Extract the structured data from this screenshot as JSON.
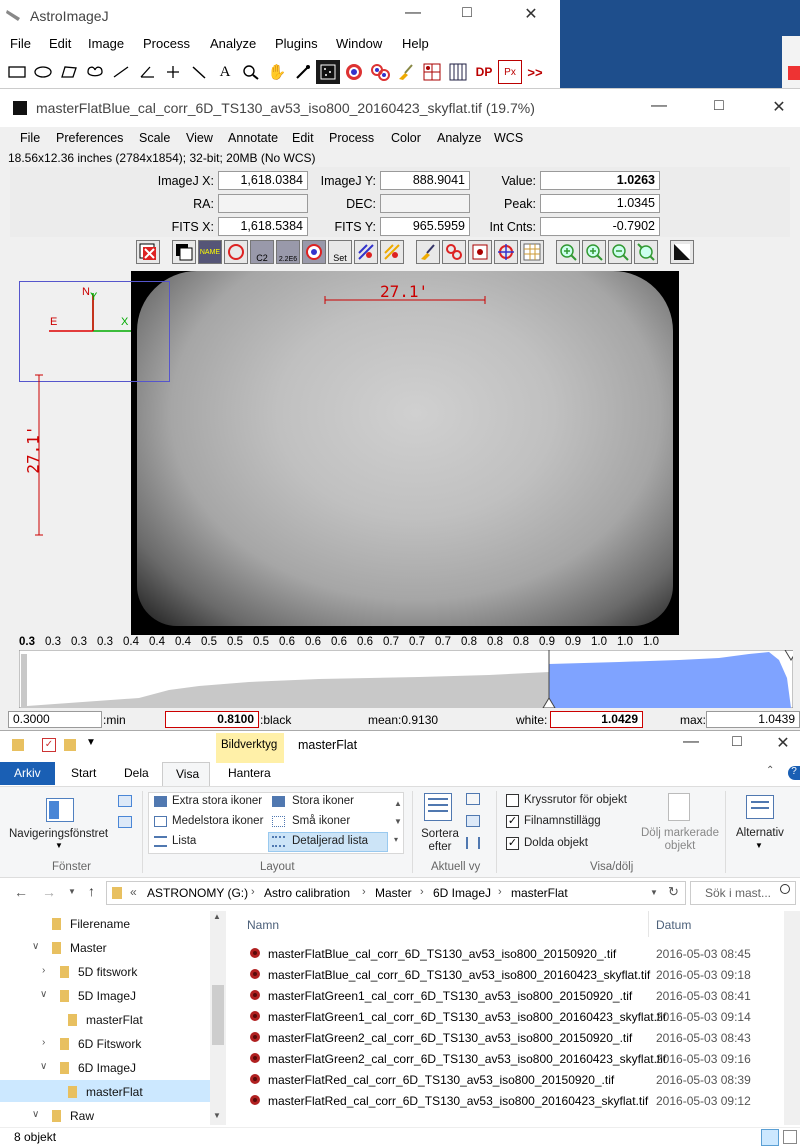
{
  "aij_main": {
    "title": "AstroImageJ",
    "menu": [
      "File",
      "Edit",
      "Image",
      "Process",
      "Analyze",
      "Plugins",
      "Window",
      "Help"
    ],
    "tools_text": {
      "text_tool": "A",
      "dp": "DP",
      "px": "Px",
      "more": ">>"
    }
  },
  "image_window": {
    "title": "masterFlatBlue_cal_corr_6D_TS130_av53_iso800_20160423_skyflat.tif (19.7%)",
    "menu": [
      "File",
      "Preferences",
      "Scale",
      "View",
      "Annotate",
      "Edit",
      "Process",
      "Color",
      "Analyze",
      "WCS"
    ],
    "info": "18.56x12.36 inches (2784x1854); 32-bit; 20MB (No WCS)",
    "fields": {
      "imagej_x_label": "ImageJ X:",
      "imagej_x": "1,618.0384",
      "imagej_y_label": "ImageJ Y:",
      "imagej_y": "888.9041",
      "value_label": "Value:",
      "value": "1.0263",
      "ra_label": "RA:",
      "ra": "",
      "dec_label": "DEC:",
      "dec": "",
      "peak_label": "Peak:",
      "peak": "1.0345",
      "fits_x_label": "FITS X:",
      "fits_x": "1,618.5384",
      "fits_y_label": "FITS Y:",
      "fits_y": "965.5959",
      "int_cnts_label": "Int Cnts:",
      "int_cnts": "-0.7902"
    },
    "icon_text": {
      "c2": "C2",
      "s2e6": "2.2E6",
      "set": "Set",
      "name": "NAME"
    },
    "scale_label": "27.1'",
    "compass": {
      "n": "N",
      "e": "E",
      "y": "Y",
      "x": "X"
    },
    "histogram_ticks": [
      "0.3",
      "0.3",
      "0.3",
      "0.3",
      "0.4",
      "0.4",
      "0.4",
      "0.5",
      "0.5",
      "0.5",
      "0.6",
      "0.6",
      "0.6",
      "0.6",
      "0.7",
      "0.7",
      "0.7",
      "0.8",
      "0.8",
      "0.8",
      "0.9",
      "0.9",
      "1.0",
      "1.0",
      "1.0"
    ],
    "bottom": {
      "min_val": "0.3000",
      "min_label": ":min",
      "black_val": "0.8100",
      "black_label": ":black",
      "mean": "mean:0.9130",
      "white_label": "white:",
      "white_val": "1.0429",
      "max_label": "max:",
      "max_val": "1.0439"
    },
    "colors": {
      "histogram_gray": "#c8c8c8",
      "histogram_blue": "#7fa3ff",
      "annotation_red": "#c00000"
    }
  },
  "explorer": {
    "context_tab": "Bildverktyg",
    "title": "masterFlat",
    "tabs": {
      "arkiv": "Arkiv",
      "start": "Start",
      "dela": "Dela",
      "visa": "Visa",
      "hantera": "Hantera"
    },
    "ribbon": {
      "nav_pane": "Navigeringsfönstret",
      "group_fonster": "Fönster",
      "layouts": [
        "Extra stora ikoner",
        "Stora ikoner",
        "Medelstora ikoner",
        "Små ikoner",
        "Lista",
        "Detaljerad lista"
      ],
      "group_layout": "Layout",
      "sort_by": "Sortera efter",
      "group_current": "Aktuell vy",
      "checkboxes": [
        {
          "label": "Kryssrutor för objekt",
          "checked": false
        },
        {
          "label": "Filnamnstillägg",
          "checked": true
        },
        {
          "label": "Dolda objekt",
          "checked": true
        }
      ],
      "hide_selected": "Dölj markerade objekt",
      "group_show_hide": "Visa/dölj",
      "options": "Alternativ"
    },
    "address": [
      "ASTRONOMY (G:)",
      "Astro calibration",
      "Master",
      "6D ImageJ",
      "masterFlat"
    ],
    "search_placeholder": "Sök i mast...",
    "tree": [
      {
        "label": "Filerename",
        "level": 1,
        "expand": ""
      },
      {
        "label": "Master",
        "level": 1,
        "expand": "v"
      },
      {
        "label": "5D fitswork",
        "level": 2,
        "expand": ">"
      },
      {
        "label": "5D ImageJ",
        "level": 2,
        "expand": "v"
      },
      {
        "label": "masterFlat",
        "level": 3,
        "expand": ""
      },
      {
        "label": "6D Fitswork",
        "level": 2,
        "expand": ">"
      },
      {
        "label": "6D ImageJ",
        "level": 2,
        "expand": "v"
      },
      {
        "label": "masterFlat",
        "level": 3,
        "expand": "",
        "selected": true
      },
      {
        "label": "Raw",
        "level": 1,
        "expand": "v"
      }
    ],
    "columns": {
      "name": "Namn",
      "date": "Datum"
    },
    "files": [
      {
        "name": "masterFlatBlue_cal_corr_6D_TS130_av53_iso800_20150920_.tif",
        "date": "2016-05-03 08:45"
      },
      {
        "name": "masterFlatBlue_cal_corr_6D_TS130_av53_iso800_20160423_skyflat.tif",
        "date": "2016-05-03 09:18"
      },
      {
        "name": "masterFlatGreen1_cal_corr_6D_TS130_av53_iso800_20150920_.tif",
        "date": "2016-05-03 08:41"
      },
      {
        "name": "masterFlatGreen1_cal_corr_6D_TS130_av53_iso800_20160423_skyflat.tif",
        "date": "2016-05-03 09:14"
      },
      {
        "name": "masterFlatGreen2_cal_corr_6D_TS130_av53_iso800_20150920_.tif",
        "date": "2016-05-03 08:43"
      },
      {
        "name": "masterFlatGreen2_cal_corr_6D_TS130_av53_iso800_20160423_skyflat.tif",
        "date": "2016-05-03 09:16"
      },
      {
        "name": "masterFlatRed_cal_corr_6D_TS130_av53_iso800_20150920_.tif",
        "date": "2016-05-03 08:39"
      },
      {
        "name": "masterFlatRed_cal_corr_6D_TS130_av53_iso800_20160423_skyflat.tif",
        "date": "2016-05-03 09:12"
      }
    ],
    "status": "8 objekt"
  }
}
